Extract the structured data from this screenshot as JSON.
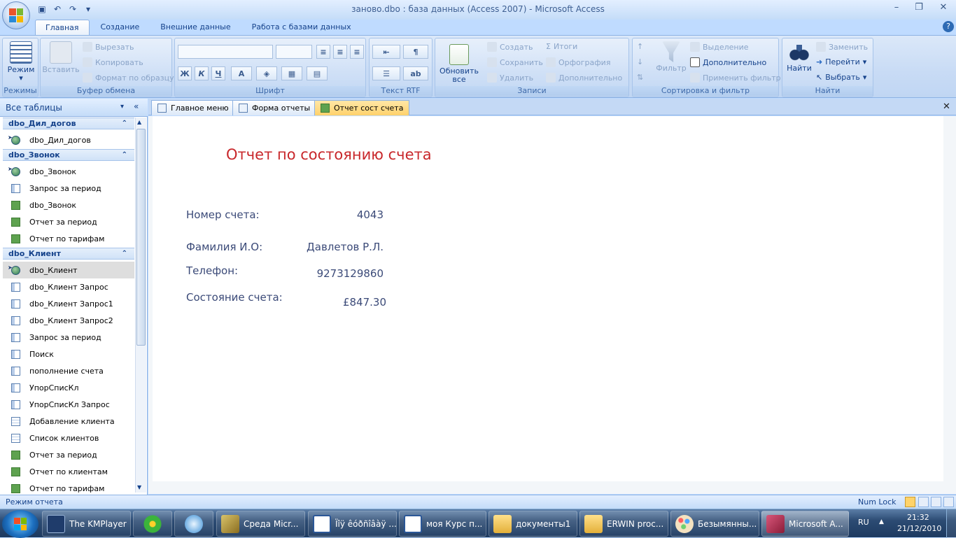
{
  "window": {
    "title": "заново.dbo : база данных (Access 2007)  -  Microsoft Access"
  },
  "ribbon_tabs": [
    "Главная",
    "Создание",
    "Внешние данные",
    "Работа с базами данных"
  ],
  "ribbon": {
    "modes": {
      "view": "Режим",
      "group": "Режимы"
    },
    "clipboard": {
      "paste": "Вставить",
      "cut": "Вырезать",
      "copy": "Копировать",
      "format_painter": "Формат по образцу",
      "group": "Буфер обмена"
    },
    "font": {
      "bold": "Ж",
      "italic": "К",
      "underline": "Ч",
      "group": "Шрифт"
    },
    "rtf": {
      "group": "Текст RTF"
    },
    "records": {
      "refresh_line1": "Обновить",
      "refresh_line2": "все",
      "new": "Создать",
      "save": "Сохранить",
      "delete": "Удалить",
      "totals": "Итоги",
      "spelling": "Орфография",
      "more": "Дополнительно",
      "group": "Записи"
    },
    "sort_filter": {
      "filter": "Фильтр",
      "selection": "Выделение",
      "advanced": "Дополнительно",
      "apply_filter": "Применить фильтр",
      "group": "Сортировка и фильтр"
    },
    "find": {
      "find": "Найти",
      "replace": "Заменить",
      "goto": "Перейти",
      "select": "Выбрать",
      "group": "Найти"
    }
  },
  "nav": {
    "header": "Все таблицы",
    "sections": [
      {
        "title": "dbo_Дил_догов",
        "items": [
          {
            "label": "dbo_Дил_догов",
            "type": "tbl",
            "arrow": true
          }
        ]
      },
      {
        "title": "dbo_Звонок",
        "items": [
          {
            "label": "dbo_Звонок",
            "type": "tbl",
            "arrow": true
          },
          {
            "label": "Запрос за период",
            "type": "query"
          },
          {
            "label": "dbo_Звонок",
            "type": "rep"
          },
          {
            "label": "Отчет за период",
            "type": "rep"
          },
          {
            "label": "Отчет по тарифам",
            "type": "rep"
          }
        ]
      },
      {
        "title": "dbo_Клиент",
        "items": [
          {
            "label": "dbo_Клиент",
            "type": "tbl",
            "arrow": true,
            "selected": true
          },
          {
            "label": "dbo_Клиент Запрос",
            "type": "query"
          },
          {
            "label": "dbo_Клиент Запрос1",
            "type": "query"
          },
          {
            "label": "dbo_Клиент Запрос2",
            "type": "query"
          },
          {
            "label": "Запрос за период",
            "type": "query"
          },
          {
            "label": "Поиск",
            "type": "query"
          },
          {
            "label": "пополнение счета",
            "type": "query"
          },
          {
            "label": "УпорСписКл",
            "type": "query"
          },
          {
            "label": "УпорСписКл Запрос",
            "type": "query"
          },
          {
            "label": "Добавление клиента",
            "type": "form"
          },
          {
            "label": "Список клиентов",
            "type": "form"
          },
          {
            "label": "Отчет за период",
            "type": "rep"
          },
          {
            "label": "Отчет по клиентам",
            "type": "rep"
          },
          {
            "label": "Отчет по тарифам",
            "type": "rep"
          }
        ]
      }
    ]
  },
  "doc_tabs": [
    {
      "label": "Главное меню",
      "active": false
    },
    {
      "label": "Форма отчеты",
      "active": false
    },
    {
      "label": "Отчет сост счета",
      "active": true
    }
  ],
  "report": {
    "title": "Отчет по состоянию счета",
    "fields": [
      {
        "label": "Номер счета:",
        "value": "4043"
      },
      {
        "label": "Фамилия И.О:",
        "value": "Давлетов Р.Л."
      },
      {
        "label": "Телефон:",
        "value": "9273129860"
      },
      {
        "label": "Состояние счета:",
        "value": "£847.30"
      }
    ]
  },
  "status": {
    "mode": "Режим отчета",
    "numlock": "Num Lock"
  },
  "taskbar": {
    "tasks": [
      "The KMPlayer",
      "Среда Micr...",
      "Ïîÿ êóðñîâàÿ ...",
      "моя Курс п...",
      "документы1",
      "ERWIN proc...",
      "Безымянны...",
      "Microsoft A..."
    ],
    "lang": "RU",
    "time": "21:32",
    "date": "21/12/2010"
  }
}
